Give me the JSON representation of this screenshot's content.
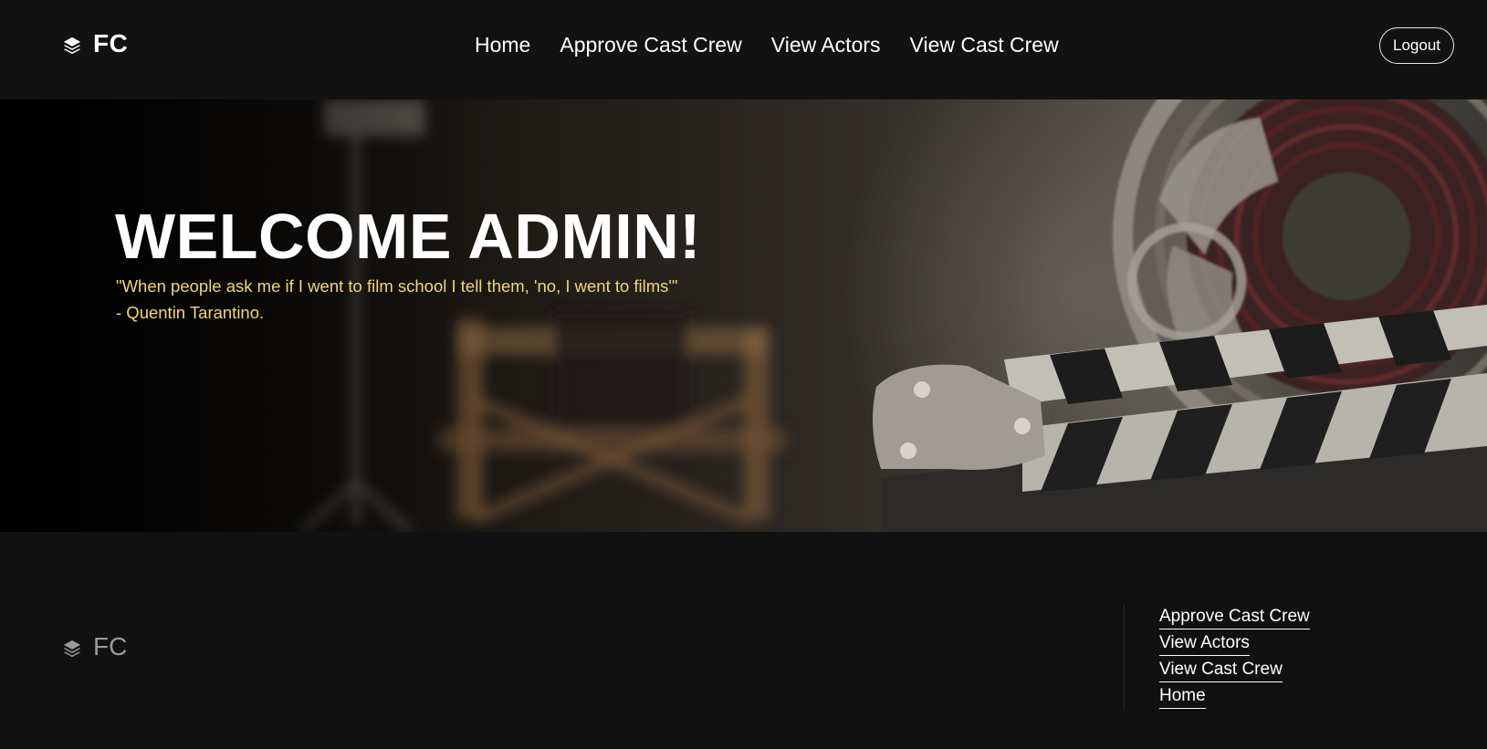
{
  "header": {
    "brand": {
      "icon": "layers-icon",
      "text": "FC"
    },
    "nav": [
      {
        "label": "Home"
      },
      {
        "label": "Approve Cast Crew"
      },
      {
        "label": "View Actors"
      },
      {
        "label": "View Cast Crew"
      }
    ],
    "logout_label": "Logout"
  },
  "hero": {
    "title": "WELCOME ADMIN!",
    "quote_line1": "\"When people ask me if I went to film school I tell them, 'no, I went to films'\"",
    "quote_line2": "- Quentin Tarantino.",
    "colors": {
      "title": "#ffffff",
      "quote": "#f3d679"
    }
  },
  "footer": {
    "brand": {
      "icon": "layers-icon",
      "text": "FC"
    },
    "links": [
      {
        "label": "Approve Cast Crew"
      },
      {
        "label": "View Actors"
      },
      {
        "label": "View Cast Crew"
      },
      {
        "label": "Home"
      }
    ]
  },
  "colors": {
    "background": "#111111",
    "header_background": "#121212",
    "text": "#ffffff",
    "muted_text": "#9a9a9a"
  }
}
